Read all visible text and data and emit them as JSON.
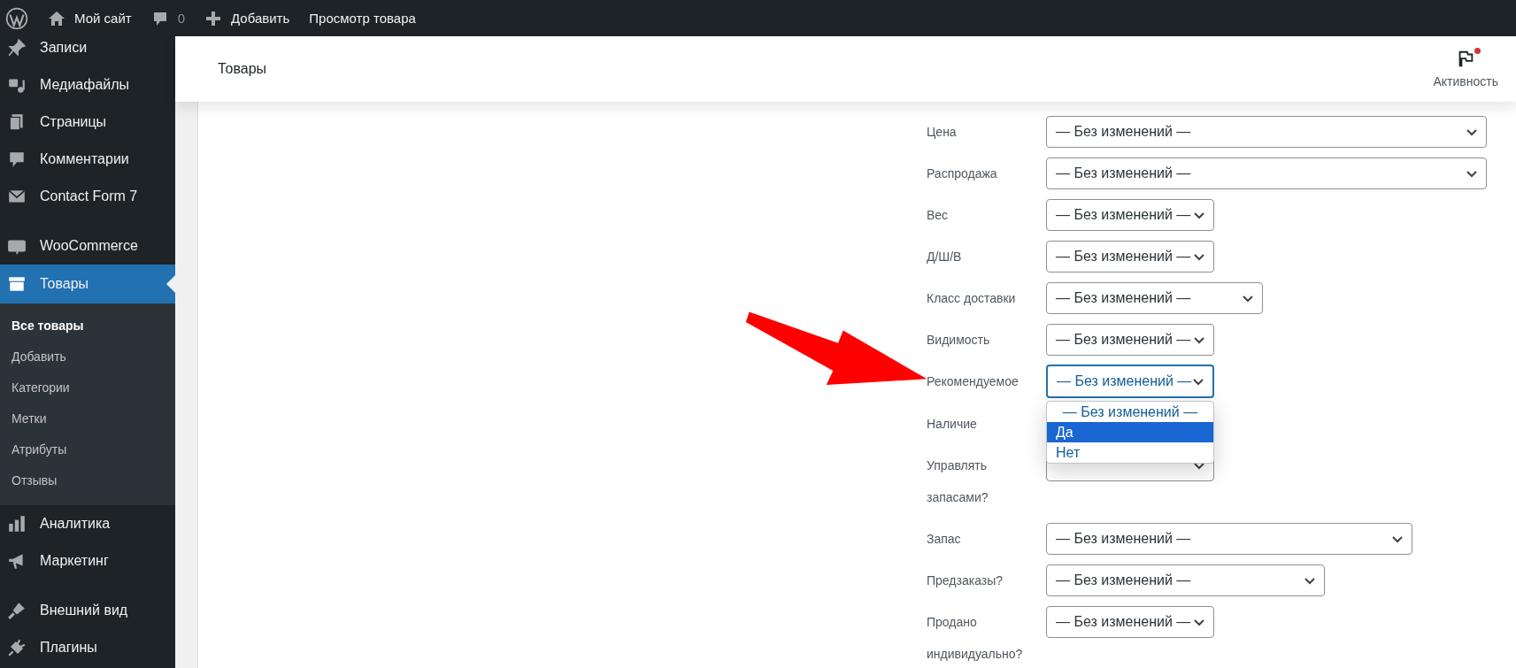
{
  "admin_bar": {
    "site_name": "Мой сайт",
    "comments_count": "0",
    "add_new": "Добавить",
    "view_product": "Просмотр товара"
  },
  "sidebar": {
    "groups": [
      {
        "items": [
          {
            "label": "Записи",
            "selected": false
          },
          {
            "label": "Медиафайлы",
            "selected": false
          },
          {
            "label": "Страницы",
            "selected": false
          },
          {
            "label": "Комментарии",
            "selected": false
          },
          {
            "label": "Contact Form 7",
            "selected": false
          }
        ]
      },
      {
        "items": [
          {
            "label": "WooCommerce",
            "selected": false
          },
          {
            "label": "Товары",
            "selected": true,
            "children": [
              {
                "label": "Все товары",
                "selected": true
              },
              {
                "label": "Добавить",
                "selected": false
              },
              {
                "label": "Категории",
                "selected": false
              },
              {
                "label": "Метки",
                "selected": false
              },
              {
                "label": "Атрибуты",
                "selected": false
              },
              {
                "label": "Отзывы",
                "selected": false
              }
            ]
          },
          {
            "label": "Аналитика",
            "selected": false
          },
          {
            "label": "Маркетинг",
            "selected": false
          }
        ]
      },
      {
        "items": [
          {
            "label": "Внешний вид",
            "selected": false
          },
          {
            "label": "Плагины",
            "selected": false
          }
        ]
      }
    ]
  },
  "header": {
    "title": "Товары",
    "activity": {
      "label": "Активность",
      "unread": true
    }
  },
  "form": {
    "rows": [
      {
        "label": "Цена",
        "select": {
          "value": "— Без изменений —",
          "focused": false
        }
      },
      {
        "label": "Распродажа",
        "select": {
          "value": "— Без изменений —",
          "focused": false
        }
      },
      {
        "label": "Вес",
        "select": {
          "value": "— Без изменений —",
          "focused": false
        }
      },
      {
        "label": "Д/Ш/В",
        "select": {
          "value": "— Без изменений —",
          "focused": false
        }
      },
      {
        "label": "Класс доставки",
        "select": {
          "value": "— Без изменений —",
          "focused": false
        }
      },
      {
        "label": "Видимость",
        "select": {
          "value": "— Без изменений —",
          "focused": false
        }
      },
      {
        "label": "Рекомендуемое",
        "select": {
          "value": "— Без изменений —",
          "focused": true,
          "options": [
            {
              "label": "— Без изменений —",
              "highlighted": false
            },
            {
              "label": "Да",
              "highlighted": true
            },
            {
              "label": "Нет",
              "highlighted": false
            }
          ]
        }
      },
      {
        "label": "Наличие"
      },
      {
        "label": "Управлять запасами?",
        "select": {
          "focused": false
        }
      },
      {
        "label": "Запас",
        "select": {
          "value": "— Без изменений —",
          "focused": false
        }
      },
      {
        "label": "Предзаказы?",
        "select": {
          "value": "— Без изменений —",
          "focused": false
        }
      },
      {
        "label": "Продано индивидуально?",
        "select": {
          "value": "— Без изменений —",
          "focused": false
        }
      }
    ]
  }
}
